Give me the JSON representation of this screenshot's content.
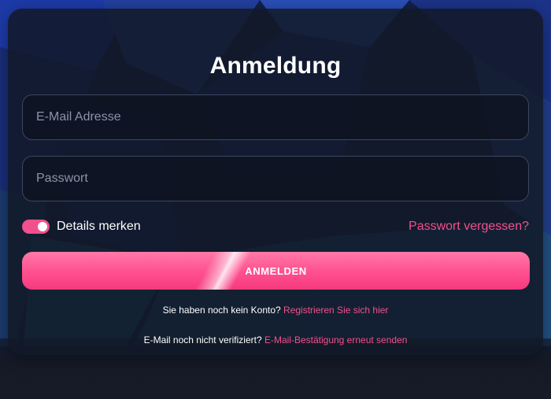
{
  "colors": {
    "accent": "#f2508c",
    "button_gradient_top": "#ff79a8",
    "button_gradient_bottom": "#f53a7d",
    "card_background": "#121826",
    "field_border": "#3c4660",
    "text_primary": "#ffffff",
    "text_placeholder": "#8b93a7"
  },
  "login": {
    "title": "Anmeldung",
    "email_placeholder": "E-Mail Adresse",
    "email_value": "",
    "password_placeholder": "Passwort",
    "password_value": "",
    "remember": {
      "label": "Details merken",
      "checked": true
    },
    "forgot_password": "Passwort vergessen?",
    "submit_label": "ANMELDEN"
  },
  "footer": {
    "register_prompt": "Sie haben noch kein Konto?",
    "register_link": "Registrieren Sie sich hier",
    "verify_prompt": "E-Mail noch nicht verifiziert?",
    "verify_link": "E-Mail-Bestätigung erneut senden"
  }
}
